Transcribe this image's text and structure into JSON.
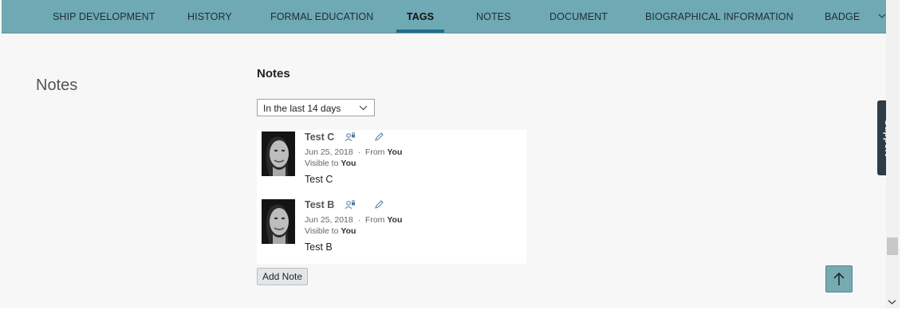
{
  "tabs": [
    {
      "label": "SHIP DEVELOPMENT"
    },
    {
      "label": "HISTORY"
    },
    {
      "label": "FORMAL EDUCATION"
    },
    {
      "label": "TAGS",
      "active": true
    },
    {
      "label": "NOTES"
    },
    {
      "label": "DOCUMENT"
    },
    {
      "label": "BIOGRAPHICAL INFORMATION"
    },
    {
      "label": "BADGE"
    }
  ],
  "section_title": "Notes",
  "notes_heading": "Notes",
  "filter": {
    "selected": "In the last 14 days"
  },
  "notes": [
    {
      "title": "Test C",
      "date": "Jun 25, 2018",
      "separator": "·",
      "from_label": "From",
      "from_value": "You",
      "visible_label": "Visible to",
      "visible_value": "You",
      "body": "Test C"
    },
    {
      "title": "Test B",
      "date": "Jun 25, 2018",
      "separator": "·",
      "from_label": "From",
      "from_value": "You",
      "visible_label": "Visible to",
      "visible_value": "You",
      "body": "Test B"
    }
  ],
  "add_note_label": "Add Note",
  "support_label": "Support",
  "icons": {
    "tab_overflow": "chevron-down-icon",
    "filter": "chevron-down-icon",
    "visibility": "user-lock-icon",
    "edit": "pencil-icon",
    "scroll_top": "arrow-up-icon"
  },
  "colors": {
    "tab_bar": "#6fa9b3",
    "active_tab_underline": "#1f6e8c",
    "support_tab": "#2f3b45",
    "scroll_top_button": "#76abb3"
  }
}
